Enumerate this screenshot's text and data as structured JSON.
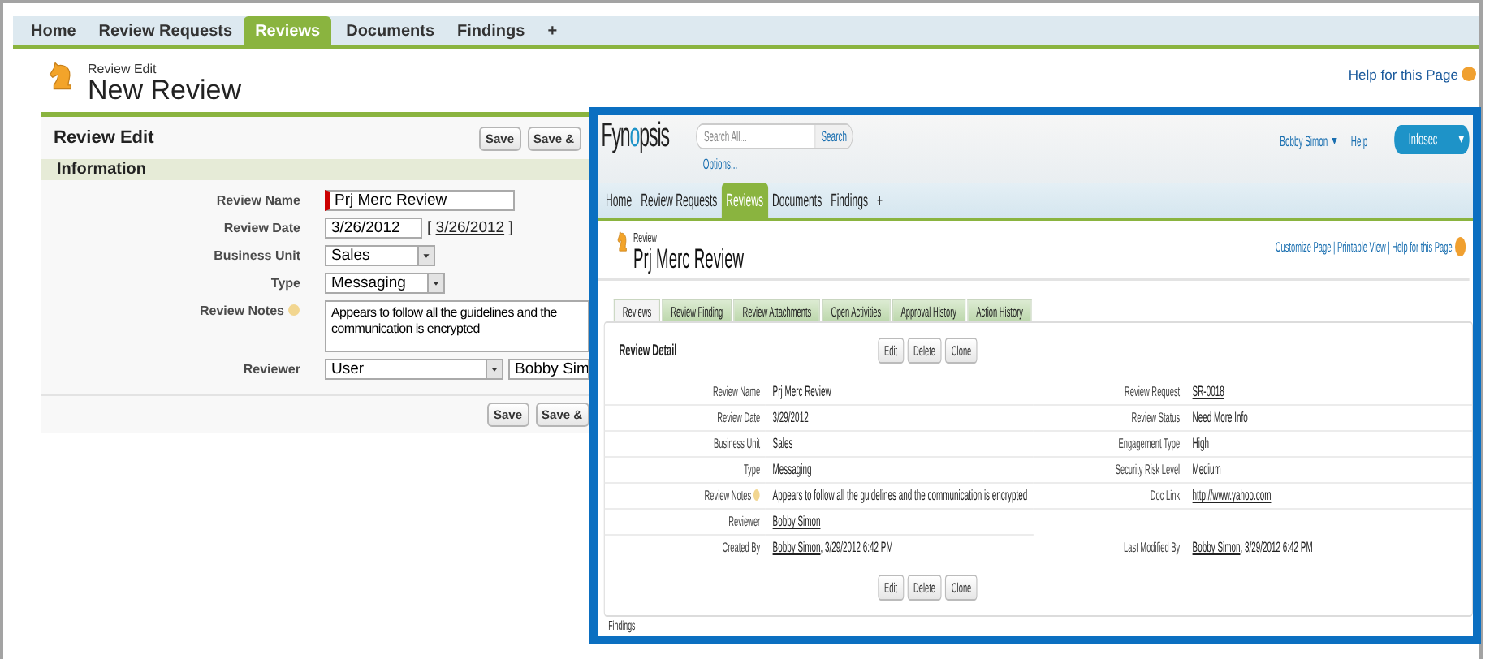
{
  "tabs": [
    {
      "label": "Home",
      "selected": false
    },
    {
      "label": "Review Requests",
      "selected": false
    },
    {
      "label": "Reviews",
      "selected": true
    },
    {
      "label": "Documents",
      "selected": false
    },
    {
      "label": "Findings",
      "selected": false
    },
    {
      "label": "+",
      "selected": false
    }
  ],
  "header": {
    "breadcrumb": "Review Edit",
    "title": "New Review",
    "help": "Help for this Page"
  },
  "edit_panel": {
    "title": "Review Edit",
    "buttons": [
      "Save",
      "Save &"
    ],
    "section": "Information",
    "fields": [
      {
        "label": "Review Name",
        "kind": "text",
        "value": "Prj Merc Review",
        "required": true,
        "help": false
      },
      {
        "label": "Review Date",
        "kind": "date",
        "value": "3/26/2012",
        "today": "3/26/2012",
        "brackets": [
          "[",
          "]"
        ],
        "required": false,
        "help": false
      },
      {
        "label": "Business Unit",
        "kind": "select",
        "value": "Sales",
        "required": false,
        "help": false
      },
      {
        "label": "Type",
        "kind": "select",
        "value": "Messaging",
        "required": false,
        "help": false
      },
      {
        "label": "Review Notes",
        "kind": "textarea",
        "value": "Appears to follow all the guidelines and the communication is encrypted",
        "required": false,
        "help": true
      },
      {
        "label": "Reviewer",
        "kind": "lookup",
        "value": "User",
        "lookup": "Bobby Sim",
        "required": false,
        "help": false
      }
    ],
    "footer_buttons": [
      "Save",
      "Save &"
    ]
  },
  "overlay": {
    "logo": [
      "Fyn",
      "o",
      "psis"
    ],
    "search": {
      "placeholder": "Search All...",
      "button": "Search",
      "options": "Options..."
    },
    "user": "Bobby Simon",
    "help": "Help",
    "app": "Infosec",
    "tabs": [
      {
        "label": "Home",
        "selected": false
      },
      {
        "label": "Review Requests",
        "selected": false
      },
      {
        "label": "Reviews",
        "selected": true
      },
      {
        "label": "Documents",
        "selected": false
      },
      {
        "label": "Findings",
        "selected": false
      },
      {
        "label": "+",
        "selected": false
      }
    ],
    "breadcrumb": "Review",
    "title": "Prj Merc Review",
    "links": [
      "Customize Page",
      "Printable View",
      "Help for this Page"
    ],
    "link_separator": "|",
    "subtabs": [
      {
        "label": "Reviews",
        "selected": true
      },
      {
        "label": "Review Finding",
        "selected": false
      },
      {
        "label": "Review Attachments",
        "selected": false
      },
      {
        "label": "Open Activities",
        "selected": false
      },
      {
        "label": "Approval History",
        "selected": false
      },
      {
        "label": "Action History",
        "selected": false
      }
    ],
    "detail": {
      "title": "Review Detail",
      "buttons": [
        "Edit",
        "Delete",
        "Clone"
      ],
      "rows": [
        {
          "left": {
            "label": "Review Name",
            "text": "Prj Merc Review"
          },
          "right": {
            "label": "Review Request",
            "link": "SR-0018"
          }
        },
        {
          "left": {
            "label": "Review Date",
            "text": "3/29/2012"
          },
          "right": {
            "label": "Review Status",
            "text": "Need More Info"
          }
        },
        {
          "left": {
            "label": "Business Unit",
            "text": "Sales"
          },
          "right": {
            "label": "Engagement Type",
            "text": "High"
          }
        },
        {
          "left": {
            "label": "Type",
            "text": "Messaging"
          },
          "right": {
            "label": "Security Risk Level",
            "text": "Medium"
          }
        },
        {
          "left": {
            "label": "Review Notes",
            "text": "Appears to follow all the guidelines and the communication is encrypted",
            "help": true
          },
          "right": {
            "label": "Doc Link",
            "link": "http://www.yahoo.com"
          }
        },
        {
          "left": {
            "label": "Reviewer",
            "link": "Bobby Simon"
          }
        },
        {
          "left": {
            "label": "Created By",
            "link": "Bobby Simon",
            "text": ", 3/29/2012 6:42 PM"
          },
          "right": {
            "label": "Last Modified By",
            "link": "Bobby Simon",
            "text": ", 3/29/2012 6:42 PM"
          }
        }
      ],
      "footer_buttons": [
        "Edit",
        "Delete",
        "Clone"
      ]
    },
    "next_section": "Findings"
  }
}
